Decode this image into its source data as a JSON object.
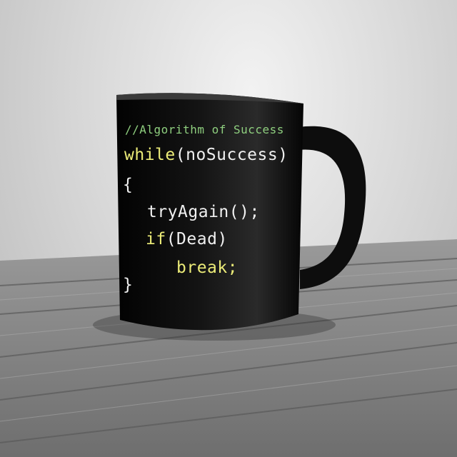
{
  "mug_code": {
    "comment": "//Algorithm of Success",
    "while_keyword": "while",
    "while_condition": "(noSuccess)",
    "open_brace": "{",
    "try_line": "tryAgain();",
    "if_keyword": "if",
    "if_condition": "(Dead)",
    "break_line": "break;",
    "close_brace": "}"
  },
  "colors": {
    "mug": "#0b0b0b",
    "comment_text": "#8fcf7f",
    "keyword_text": "#ecec78",
    "code_text": "#f0f0f0",
    "wood": "#8e8e8e"
  }
}
